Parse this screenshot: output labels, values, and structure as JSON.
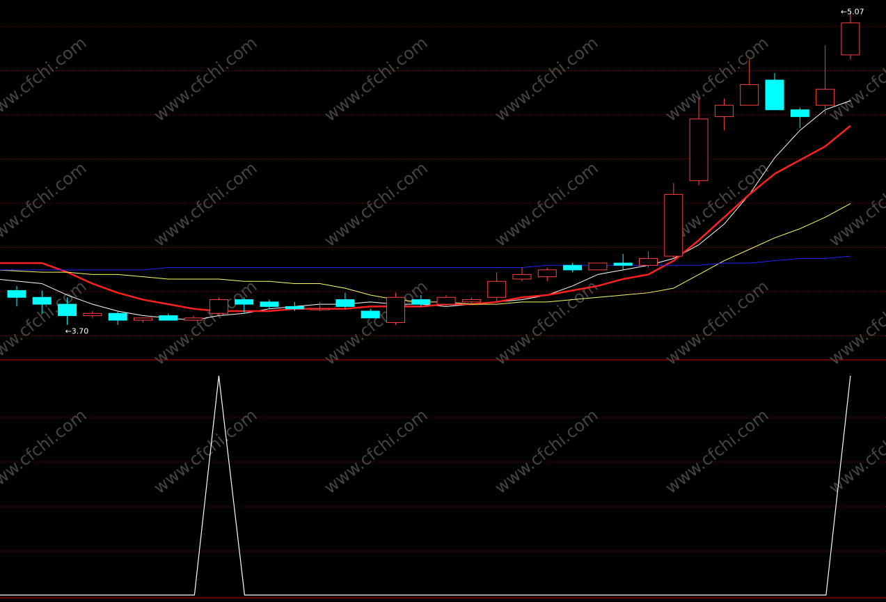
{
  "chart_data": {
    "type": "candlestick",
    "price_range": [
      3.55,
      5.12
    ],
    "annotations": {
      "high_label": "5.07",
      "low_label": "3.70",
      "high_arrow": "←",
      "low_arrow": "←"
    },
    "candles": [
      {
        "o": 3.85,
        "h": 3.87,
        "l": 3.78,
        "c": 3.82
      },
      {
        "o": 3.82,
        "h": 3.85,
        "l": 3.75,
        "c": 3.79
      },
      {
        "o": 3.79,
        "h": 3.82,
        "l": 3.7,
        "c": 3.74
      },
      {
        "o": 3.74,
        "h": 3.76,
        "l": 3.73,
        "c": 3.75
      },
      {
        "o": 3.75,
        "h": 3.76,
        "l": 3.7,
        "c": 3.72
      },
      {
        "o": 3.72,
        "h": 3.73,
        "l": 3.71,
        "c": 3.73
      },
      {
        "o": 3.74,
        "h": 3.75,
        "l": 3.72,
        "c": 3.72
      },
      {
        "o": 3.72,
        "h": 3.74,
        "l": 3.72,
        "c": 3.73
      },
      {
        "o": 3.75,
        "h": 3.82,
        "l": 3.74,
        "c": 3.81
      },
      {
        "o": 3.81,
        "h": 3.82,
        "l": 3.75,
        "c": 3.79
      },
      {
        "o": 3.8,
        "h": 3.81,
        "l": 3.77,
        "c": 3.78
      },
      {
        "o": 3.78,
        "h": 3.8,
        "l": 3.76,
        "c": 3.77
      },
      {
        "o": 3.77,
        "h": 3.8,
        "l": 3.76,
        "c": 3.77
      },
      {
        "o": 3.81,
        "h": 3.84,
        "l": 3.77,
        "c": 3.78
      },
      {
        "o": 3.76,
        "h": 3.77,
        "l": 3.73,
        "c": 3.73
      },
      {
        "o": 3.71,
        "h": 3.84,
        "l": 3.7,
        "c": 3.82
      },
      {
        "o": 3.81,
        "h": 3.83,
        "l": 3.78,
        "c": 3.79
      },
      {
        "o": 3.79,
        "h": 3.83,
        "l": 3.78,
        "c": 3.82
      },
      {
        "o": 3.8,
        "h": 3.82,
        "l": 3.79,
        "c": 3.81
      },
      {
        "o": 3.82,
        "h": 3.93,
        "l": 3.8,
        "c": 3.89
      },
      {
        "o": 3.9,
        "h": 3.95,
        "l": 3.89,
        "c": 3.92
      },
      {
        "o": 3.91,
        "h": 3.95,
        "l": 3.89,
        "c": 3.94
      },
      {
        "o": 3.96,
        "h": 3.97,
        "l": 3.93,
        "c": 3.94
      },
      {
        "o": 3.94,
        "h": 3.97,
        "l": 3.94,
        "c": 3.97
      },
      {
        "o": 3.97,
        "h": 4.01,
        "l": 3.94,
        "c": 3.96
      },
      {
        "o": 3.96,
        "h": 4.02,
        "l": 3.95,
        "c": 3.99
      },
      {
        "o": 4.0,
        "h": 4.32,
        "l": 3.99,
        "c": 4.27
      },
      {
        "o": 4.33,
        "h": 4.69,
        "l": 4.31,
        "c": 4.6
      },
      {
        "o": 4.61,
        "h": 4.69,
        "l": 4.55,
        "c": 4.66
      },
      {
        "o": 4.66,
        "h": 4.86,
        "l": 4.69,
        "c": 4.75
      },
      {
        "o": 4.77,
        "h": 4.8,
        "l": 4.64,
        "c": 4.64
      },
      {
        "o": 4.64,
        "h": 4.65,
        "l": 4.56,
        "c": 4.61
      },
      {
        "o": 4.66,
        "h": 4.92,
        "l": 4.62,
        "c": 4.73
      },
      {
        "o": 4.88,
        "h": 5.07,
        "l": 4.86,
        "c": 5.02
      }
    ],
    "moving_averages": [
      {
        "name": "",
        "color": "#ffffff",
        "width": 1,
        "values": [
          3.9,
          3.88,
          3.83,
          3.79,
          3.76,
          3.74,
          3.73,
          3.72,
          3.74,
          3.75,
          3.77,
          3.78,
          3.79,
          3.79,
          3.8,
          3.79,
          3.79,
          3.78,
          3.79,
          3.8,
          3.81,
          3.83,
          3.87,
          3.92,
          3.94,
          3.96,
          3.99,
          4.05,
          4.14,
          4.27,
          4.43,
          4.55,
          4.64,
          4.68
        ]
      },
      {
        "name": "",
        "color": "#ff2020",
        "width": 2.5,
        "values": [
          3.97,
          3.97,
          3.93,
          3.88,
          3.84,
          3.81,
          3.79,
          3.77,
          3.76,
          3.76,
          3.76,
          3.77,
          3.77,
          3.77,
          3.78,
          3.78,
          3.78,
          3.79,
          3.79,
          3.8,
          3.82,
          3.83,
          3.85,
          3.87,
          3.9,
          3.92,
          3.98,
          4.07,
          4.17,
          4.27,
          4.36,
          4.42,
          4.48,
          4.57
        ]
      },
      {
        "name": "",
        "color": "#ffff66",
        "width": 1,
        "values": [
          3.94,
          3.93,
          3.93,
          3.92,
          3.92,
          3.91,
          3.9,
          3.9,
          3.9,
          3.89,
          3.89,
          3.88,
          3.88,
          3.86,
          3.83,
          3.81,
          3.8,
          3.8,
          3.79,
          3.79,
          3.8,
          3.8,
          3.81,
          3.82,
          3.83,
          3.84,
          3.86,
          3.92,
          3.98,
          4.03,
          4.08,
          4.12,
          4.17,
          4.23
        ]
      },
      {
        "name": "",
        "color": "#2222ff",
        "width": 1,
        "values": [
          3.94,
          3.94,
          3.94,
          3.94,
          3.94,
          3.94,
          3.95,
          3.95,
          3.95,
          3.95,
          3.95,
          3.95,
          3.95,
          3.95,
          3.95,
          3.95,
          3.95,
          3.95,
          3.95,
          3.95,
          3.95,
          3.96,
          3.96,
          3.96,
          3.96,
          3.96,
          3.96,
          3.96,
          3.97,
          3.97,
          3.98,
          3.99,
          3.99,
          4.0
        ]
      }
    ],
    "indicator": {
      "type": "line",
      "color": "#ffffff",
      "ylim": [
        0,
        1
      ],
      "values": [
        0,
        0,
        0,
        0,
        0,
        0,
        0,
        0,
        1,
        0,
        0,
        0,
        0,
        0,
        0,
        0,
        0,
        0,
        0,
        0,
        0,
        0,
        0,
        0,
        0,
        0,
        0,
        0,
        0,
        0,
        0,
        0,
        0,
        1
      ]
    },
    "colors": {
      "background": "#000000",
      "up": "#ff4040",
      "down": "#00ffff",
      "grid": "#7a1010",
      "divider": "#cc0000",
      "watermark": "#444444"
    },
    "watermark_text": "www.cfchi.com",
    "grid": true
  }
}
